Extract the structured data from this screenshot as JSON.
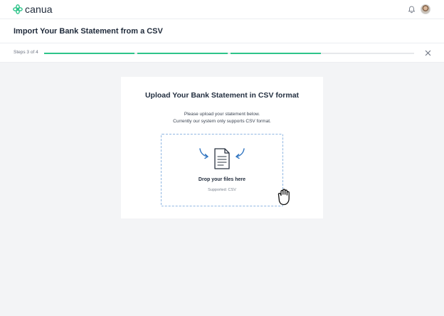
{
  "brand": {
    "name": "canua",
    "accent": "#2ec48a"
  },
  "topbar": {
    "notifications_icon": "bell-icon",
    "avatar_icon": "user-avatar"
  },
  "header": {
    "title": "Import Your Bank Statement from a CSV"
  },
  "steps": {
    "label": "Steps 3 of 4",
    "total": 4,
    "completed": 3,
    "close_icon": "close-icon"
  },
  "upload": {
    "title": "Upload Your Bank Statement in CSV format",
    "description_line1": "Please upload your statement below.",
    "description_line2": "Currently our system only supports CSV format.",
    "dropzone_title": "Drop your files here",
    "dropzone_supported": "Supported: CSV",
    "dropzone_icon": "document-icon",
    "cursor_icon": "grab-hand-icon"
  }
}
